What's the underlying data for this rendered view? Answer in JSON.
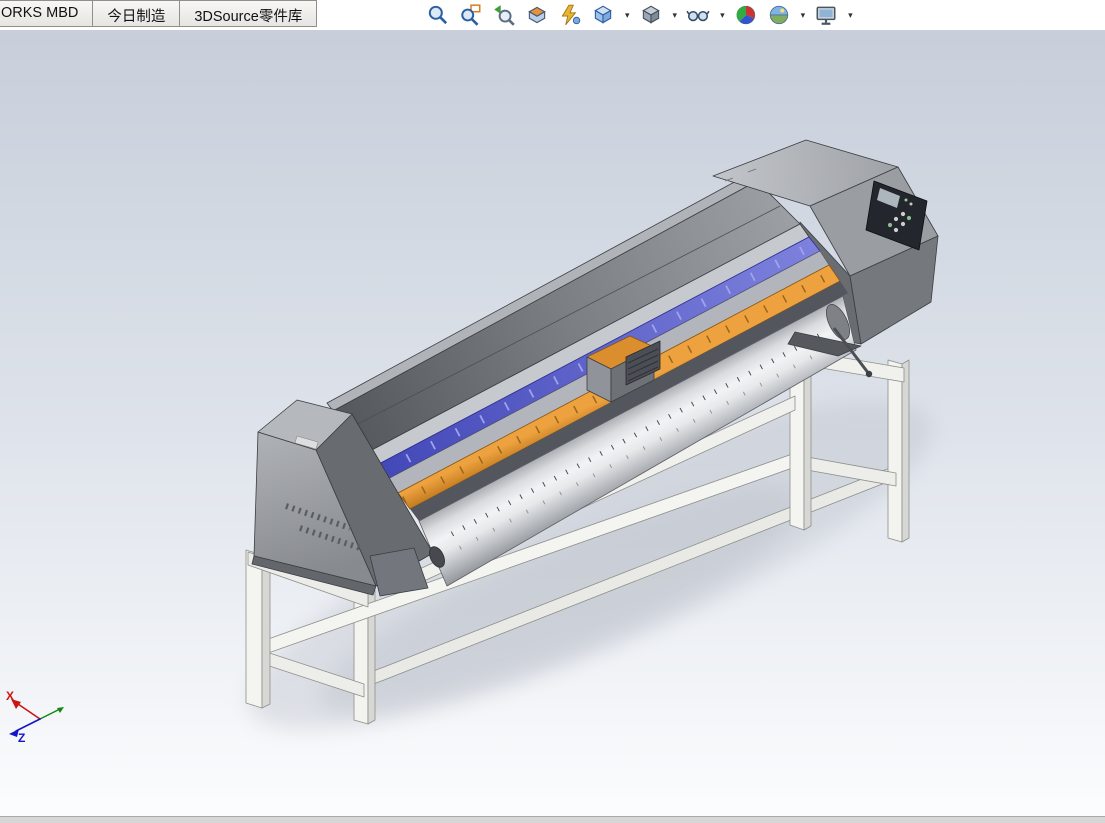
{
  "tabs": {
    "items": [
      {
        "label": "ORKS MBD"
      },
      {
        "label": "今日制造"
      },
      {
        "label": "3DSource零件库"
      }
    ]
  },
  "toolbar": {
    "dropdown_glyph": "▾",
    "items": [
      {
        "name": "zoom-to-fit",
        "has_dropdown": false
      },
      {
        "name": "zoom-to-area",
        "has_dropdown": false
      },
      {
        "name": "previous-view",
        "has_dropdown": false
      },
      {
        "name": "section-view",
        "has_dropdown": false
      },
      {
        "name": "annotation-views",
        "has_dropdown": false
      },
      {
        "name": "view-orientation",
        "has_dropdown": true
      },
      {
        "name": "display-style",
        "has_dropdown": true
      },
      {
        "name": "hide-show-items",
        "has_dropdown": true
      },
      {
        "name": "edit-appearance",
        "has_dropdown": false
      },
      {
        "name": "apply-scene",
        "has_dropdown": true
      },
      {
        "name": "view-settings",
        "has_dropdown": true
      }
    ]
  },
  "viewport": {
    "model_name": "wide-format-printer-3d-model",
    "background_top": "#c6cdd9",
    "background_bottom": "#fcfdfe"
  },
  "model_colors": {
    "body_gray": "#7b7e83",
    "accent_blue": "#5a5fd0",
    "accent_orange": "#d8892b",
    "platen_silver": "#eceef0",
    "stand_white": "#f2f2ef"
  },
  "triad": {
    "x_label": "X",
    "z_label": "Z"
  }
}
